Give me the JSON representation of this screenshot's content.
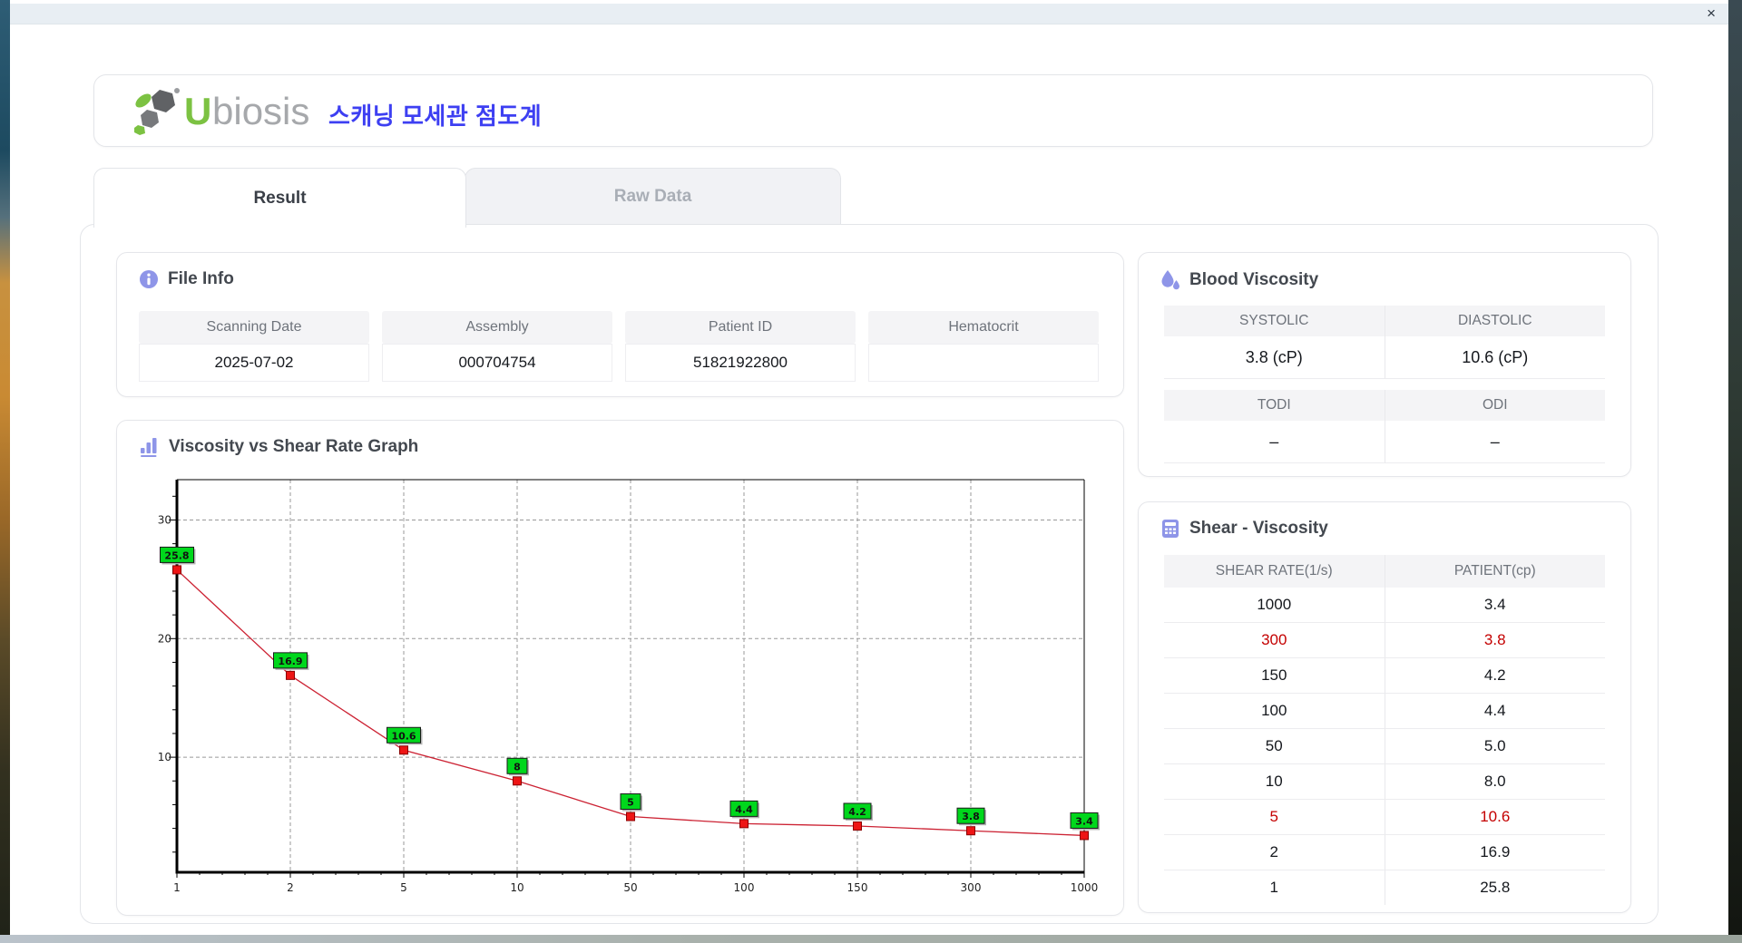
{
  "window": {
    "close_label": "×"
  },
  "header": {
    "logo_text_u": "U",
    "logo_text_rest": "biosis",
    "app_title": "스캐닝 모세관 점도계"
  },
  "tabs": [
    {
      "label": "Result",
      "active": true
    },
    {
      "label": "Raw Data",
      "active": false
    }
  ],
  "file_info": {
    "title": "File Info",
    "fields": [
      {
        "label": "Scanning Date",
        "value": "2025-07-02"
      },
      {
        "label": "Assembly",
        "value": "000704754"
      },
      {
        "label": "Patient ID",
        "value": "51821922800"
      },
      {
        "label": "Hematocrit",
        "value": ""
      }
    ]
  },
  "blood_viscosity": {
    "title": "Blood Viscosity",
    "sections": [
      {
        "headers": [
          "SYSTOLIC",
          "DIASTOLIC"
        ],
        "values": [
          "3.8 (cP)",
          "10.6 (cP)"
        ]
      },
      {
        "headers": [
          "TODI",
          "ODI"
        ],
        "values": [
          "–",
          "–"
        ]
      }
    ]
  },
  "shear_viscosity": {
    "title": "Shear - Viscosity",
    "columns": [
      "SHEAR RATE(1/s)",
      "PATIENT(cp)"
    ],
    "rows": [
      {
        "shear_rate": "1000",
        "patient": "3.4",
        "highlight": false
      },
      {
        "shear_rate": "300",
        "patient": "3.8",
        "highlight": true
      },
      {
        "shear_rate": "150",
        "patient": "4.2",
        "highlight": false
      },
      {
        "shear_rate": "100",
        "patient": "4.4",
        "highlight": false
      },
      {
        "shear_rate": "50",
        "patient": "5.0",
        "highlight": false
      },
      {
        "shear_rate": "10",
        "patient": "8.0",
        "highlight": false
      },
      {
        "shear_rate": "5",
        "patient": "10.6",
        "highlight": true
      },
      {
        "shear_rate": "2",
        "patient": "16.9",
        "highlight": false
      },
      {
        "shear_rate": "1",
        "patient": "25.8",
        "highlight": false
      }
    ]
  },
  "graph": {
    "title": "Viscosity vs Shear Rate Graph"
  },
  "chart_data": {
    "type": "line",
    "title": "Viscosity vs Shear Rate Graph",
    "x_categories": [
      "1",
      "2",
      "5",
      "10",
      "50",
      "100",
      "150",
      "300",
      "1000"
    ],
    "values": [
      25.8,
      16.9,
      10.6,
      8,
      5,
      4.4,
      4.2,
      3.8,
      3.4
    ],
    "point_labels": [
      "25.8",
      "16.9",
      "10.6",
      "8",
      "5",
      "4.4",
      "4.2",
      "3.8",
      "3.4"
    ],
    "xlabel": "",
    "ylabel": "",
    "y_ticks": [
      10,
      20,
      30
    ],
    "ylim": [
      0.3,
      33.4
    ],
    "x_scale": "categorical-log",
    "grid": true,
    "legend": "none",
    "line_color": "#cc2233",
    "marker_color": "#ee1515",
    "marker_border": "#8b0000",
    "label_bg": "#00d71c",
    "grid_color": "#999999",
    "accent_icon_color": "#8e95e8",
    "highlight_color": "#c40000"
  }
}
